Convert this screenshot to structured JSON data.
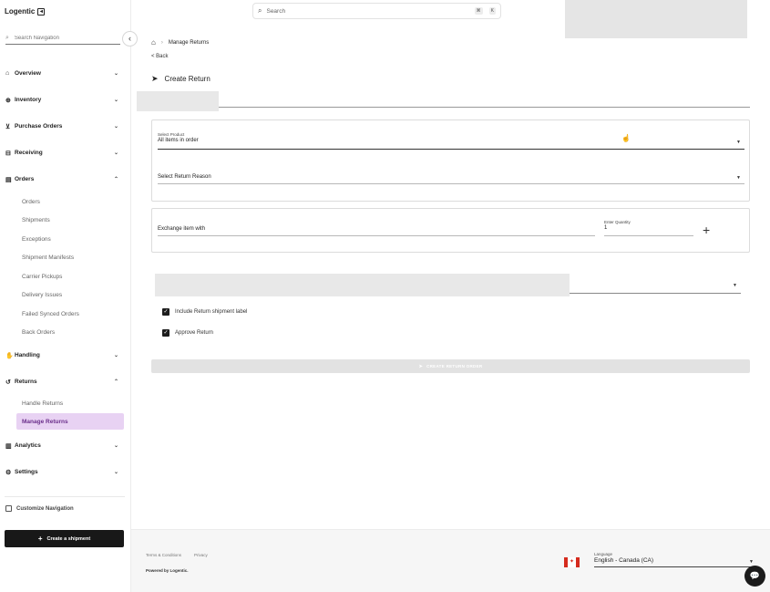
{
  "brand": {
    "name": "Logentic",
    "logo_icon": "sidebar-toggle-icon"
  },
  "sidebar": {
    "search_placeholder": "Search Navigation",
    "sections": [
      {
        "label": "Overview",
        "icon": "home-icon",
        "expanded": false
      },
      {
        "label": "Inventory",
        "icon": "box-icon",
        "expanded": false
      },
      {
        "label": "Purchase Orders",
        "icon": "cart-icon",
        "expanded": false
      },
      {
        "label": "Receiving",
        "icon": "receiving-icon",
        "expanded": false
      },
      {
        "label": "Orders",
        "icon": "document-icon",
        "expanded": true
      },
      {
        "label": "Handling",
        "icon": "hand-icon",
        "expanded": false
      },
      {
        "label": "Returns",
        "icon": "return-icon",
        "expanded": true
      },
      {
        "label": "Analytics",
        "icon": "bar-chart-icon",
        "expanded": false
      },
      {
        "label": "Settings",
        "icon": "gear-icon",
        "expanded": false
      }
    ],
    "orders_items": [
      "Orders",
      "Shipments",
      "Exceptions",
      "Shipment Manifests",
      "Carrier Pickups",
      "Delivery Issues",
      "Failed Synced Orders",
      "Back Orders"
    ],
    "returns_items": [
      "Handle Returns",
      "Manage Returns"
    ],
    "active_item": "Manage Returns",
    "customize_label": "Customize Navigation",
    "create_shipment_label": "Create a shipment"
  },
  "topbar": {
    "search_placeholder": "Search",
    "shortcut_cmd": "⌘",
    "shortcut_key": "K"
  },
  "breadcrumb": {
    "current": "Manage Returns"
  },
  "back_label": "< Back",
  "page_title": "Create Return",
  "form": {
    "select_product_label": "Select Product",
    "select_product_value": "All items in order",
    "return_reason_placeholder": "Select Return Reason",
    "exchange_placeholder": "Exchange item with",
    "quantity_label": "Enter Quantity",
    "quantity_value": "1",
    "include_label": "Include Return shipment label",
    "include_checked": true,
    "approve_label": "Approve Return",
    "approve_checked": true,
    "submit_label": "CREATE RETURN ORDER"
  },
  "footer": {
    "terms": "Terms & Conditions",
    "privacy": "Privacy",
    "powered_by": "Powered by Logentic.",
    "language_label": "Language",
    "language_value": "English - Canada (CA)"
  },
  "colors": {
    "active_bg": "#e8d2f3",
    "active_text": "#6b2f8b",
    "primary_dark": "#181818"
  }
}
